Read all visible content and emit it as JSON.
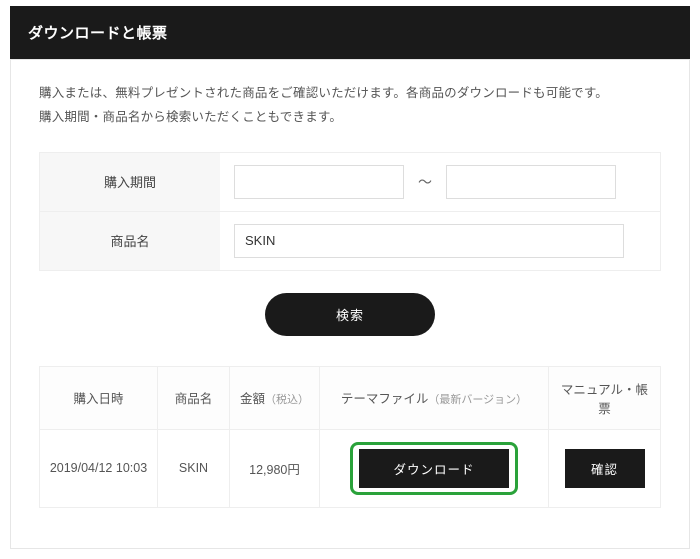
{
  "header": {
    "title": "ダウンロードと帳票"
  },
  "intro": {
    "line1": "購入または、無料プレゼントされた商品をご確認いただけます。各商品のダウンロードも可能です。",
    "line2": "購入期間・商品名から検索いただくこともできます。"
  },
  "search": {
    "period_label": "購入期間",
    "date_from": "",
    "date_to": "",
    "tilde": "〜",
    "name_label": "商品名",
    "name_value": "SKIN",
    "submit_label": "検索"
  },
  "table": {
    "headers": {
      "datetime": "購入日時",
      "product": "商品名",
      "amount": "金額",
      "amount_sub": "（税込）",
      "themefile": "テーマファイル",
      "themefile_sub": "（最新バージョン）",
      "manual": "マニュアル・帳票"
    },
    "rows": [
      {
        "datetime": "2019/04/12 10:03",
        "product": "SKIN",
        "amount": "12,980円",
        "download_label": "ダウンロード",
        "confirm_label": "確認"
      }
    ]
  }
}
